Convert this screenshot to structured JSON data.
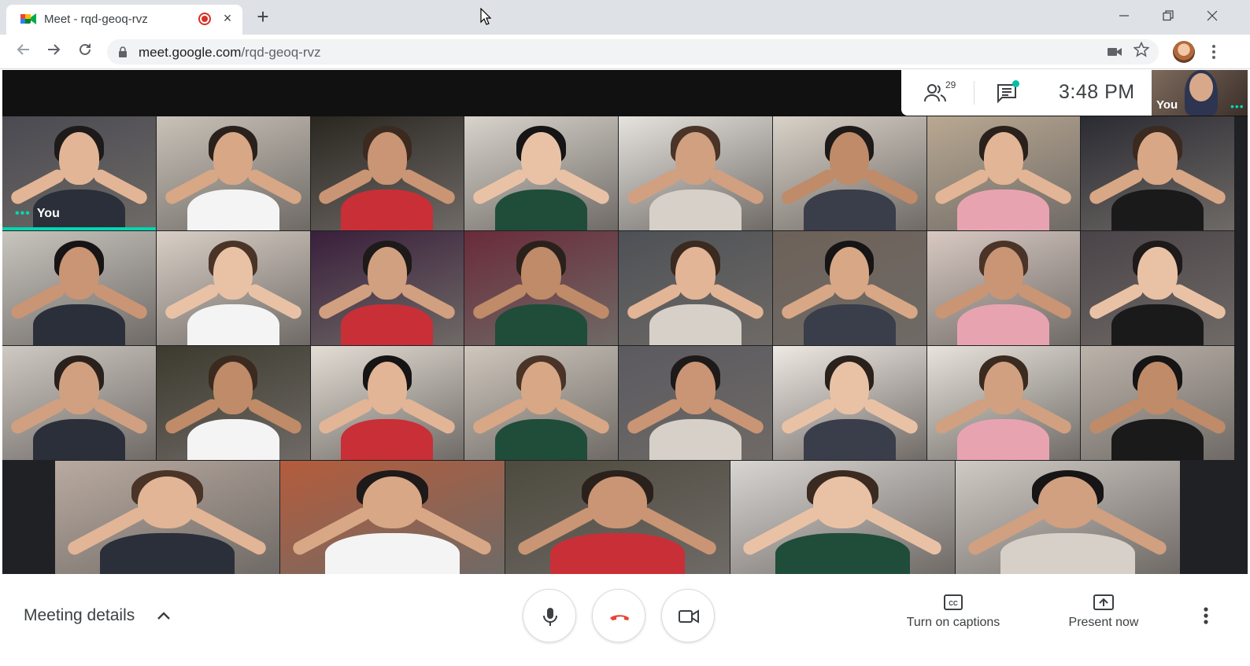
{
  "browser": {
    "tab_title": "Meet - rqd-geoq-rvz",
    "new_tab_symbol": "+",
    "close_symbol": "×",
    "url_host": "meet.google.com",
    "url_path": "/rqd-geoq-rvz",
    "window_controls": [
      "minimize",
      "restore",
      "close"
    ]
  },
  "meet_header": {
    "participant_count": "29",
    "clock": "3:48 PM",
    "self_view_label": "You",
    "self_view_menu": "•••"
  },
  "grid": {
    "self_tile_label": "You",
    "self_tile_menu": "•••",
    "tile_colors": [
      [
        "#4a4a52",
        "#c9c2b8",
        "#2a2620",
        "#d8d4cc",
        "#e6e3df",
        "#d9d2c8",
        "#b9a892",
        "#2b2b33"
      ],
      [
        "#c8c4be",
        "#d9cfc6",
        "#3a1f3c",
        "#6a2b3a",
        "#4d5156",
        "#6d6259",
        "#d8c9c2",
        "#4a4348"
      ],
      [
        "#cfc9c3",
        "#3c3a2e",
        "#e3ddd4",
        "#cfc7bd",
        "#5b5a60",
        "#efe9e4",
        "#e8e4dc",
        "#bcb3aa"
      ],
      [
        "#b9aaa0",
        "#b55c3c",
        "#4d4a3e",
        "#d9d5d2",
        "#cfcac4"
      ]
    ]
  },
  "controls": {
    "meeting_details": "Meeting details",
    "captions_label": "Turn on captions",
    "present_label": "Present now",
    "accent": "#00d7b0",
    "hangup_color": "#ea4335"
  }
}
